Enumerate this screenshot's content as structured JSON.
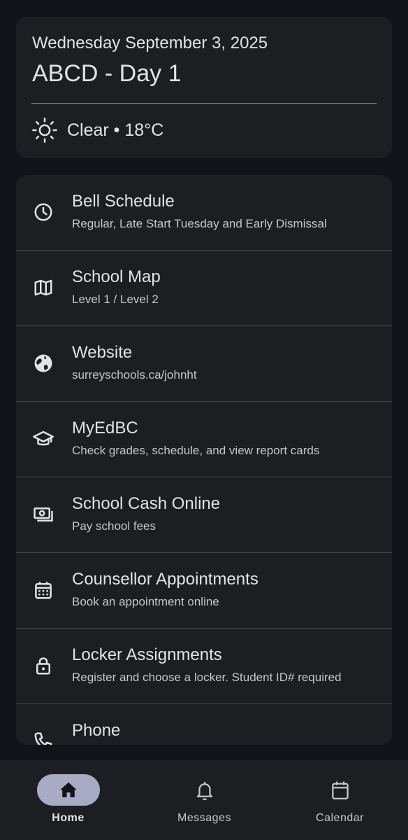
{
  "header": {
    "date": "Wednesday September 3, 2025",
    "day": "ABCD - Day 1",
    "weather": "Clear • 18°C",
    "weather_icon": "sun-icon"
  },
  "links": [
    {
      "title": "Bell Schedule",
      "subtitle": "Regular, Late Start Tuesday and Early Dismissal",
      "icon": "clock-icon"
    },
    {
      "title": "School Map",
      "subtitle": "Level 1 / Level 2",
      "icon": "map-icon"
    },
    {
      "title": "Website",
      "subtitle": "surreyschools.ca/johnht",
      "icon": "globe-icon"
    },
    {
      "title": "MyEdBC",
      "subtitle": "Check grades, schedule, and view report cards",
      "icon": "graduation-cap-icon"
    },
    {
      "title": "School Cash Online",
      "subtitle": "Pay school fees",
      "icon": "money-icon"
    },
    {
      "title": "Counsellor Appointments",
      "subtitle": "Book an appointment online",
      "icon": "calendar-grid-icon"
    },
    {
      "title": "Locker Assignments",
      "subtitle": "Register and choose a locker. Student ID# required",
      "icon": "lock-icon"
    },
    {
      "title": "Phone",
      "subtitle": "",
      "icon": "phone-icon"
    }
  ],
  "nav": {
    "items": [
      {
        "label": "Home",
        "icon": "home-icon",
        "active": true
      },
      {
        "label": "Messages",
        "icon": "bell-icon",
        "active": false
      },
      {
        "label": "Calendar",
        "icon": "calendar-icon",
        "active": false
      }
    ]
  },
  "colors": {
    "background": "#111318",
    "surface": "#1d1e22",
    "active_pill": "#a8abc4",
    "text": "#e3e2e6"
  }
}
